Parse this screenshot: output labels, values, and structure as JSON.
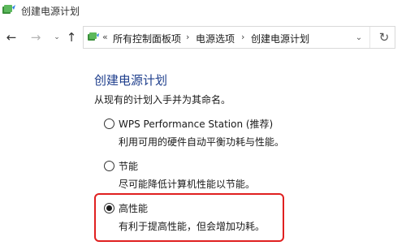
{
  "window": {
    "title": "创建电源计划"
  },
  "nav": {
    "back_icon": "arrow-left-icon",
    "forward_icon": "arrow-right-icon",
    "history_icon": "chevron-down-icon",
    "up_icon": "arrow-up-icon"
  },
  "address": {
    "chevrons": "«",
    "breadcrumbs": [
      "所有控制面板项",
      "电源选项",
      "创建电源计划"
    ],
    "separator": "›",
    "dropdown_icon": "chevron-down-icon",
    "refresh_icon": "refresh-icon"
  },
  "main": {
    "title": "创建电源计划",
    "description": "从现有的计划入手并为其命名。",
    "options": [
      {
        "label": "WPS Performance Station (推荐)",
        "description": "利用可用的硬件自动平衡功耗与性能。",
        "selected": false
      },
      {
        "label": "节能",
        "description": "尽可能降低计算机性能以节能。",
        "selected": false
      },
      {
        "label": "高性能",
        "description": "有利于提高性能，但会增加功耗。",
        "selected": true
      }
    ]
  },
  "colors": {
    "title_blue": "#1e3e8c",
    "highlight_red": "#e02020"
  }
}
